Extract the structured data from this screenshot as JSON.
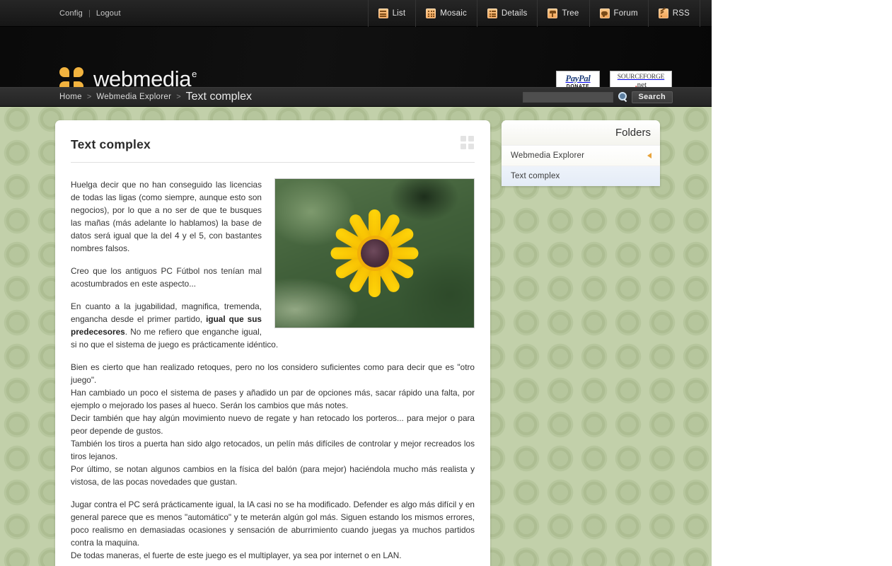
{
  "topbar": {
    "config_label": "Config",
    "separator": "|",
    "logout_label": "Logout",
    "nav": [
      {
        "label": "List",
        "icon": "list-icon"
      },
      {
        "label": "Mosaic",
        "icon": "mosaic-icon"
      },
      {
        "label": "Details",
        "icon": "details-icon"
      },
      {
        "label": "Tree",
        "icon": "tree-icon"
      },
      {
        "label": "Forum",
        "icon": "forum-icon"
      },
      {
        "label": "RSS",
        "icon": "rss-icon"
      }
    ]
  },
  "masthead": {
    "logo_text": "webmedia",
    "logo_superscript": "e",
    "logo_mark": "four-petal-flower-icon",
    "badges": {
      "paypal_line1": "PayPal",
      "paypal_line2": "DONATE",
      "sourceforge_line1": "SOURCEFORGE",
      "sourceforge_line2_dot": ".",
      "sourceforge_line2_net": "net"
    }
  },
  "breadcrumb": {
    "items": [
      "Home",
      "Webmedia Explorer",
      "Text complex"
    ],
    "separator": ">"
  },
  "search": {
    "value": "",
    "placeholder": "",
    "button_label": "Search",
    "icon": "search-icon"
  },
  "article": {
    "title": "Text complex",
    "grid_toggle_icon": "grid-view-icon",
    "image": {
      "alt": "yellow flower",
      "petal_count": 12
    },
    "paragraphs": [
      {
        "id": "p1",
        "text": "Huelga decir que no han conseguido las licencias de todas las ligas (como siempre, aunque esto son negocios), por lo que a no ser de que te busques las mañas (más adelante lo hablamos) la base de datos será igual que la del 4 y el 5, con bastantes nombres falsos."
      },
      {
        "id": "p2",
        "text": "Creo que los antiguos PC Fútbol nos tenían mal acostumbrados en este aspecto..."
      },
      {
        "id": "p3a",
        "text": "En cuanto a la jugabilidad, magnifica, tremenda, engancha desde el primer partido, "
      },
      {
        "id": "p3bold",
        "text": "igual que sus predecesores"
      },
      {
        "id": "p3b",
        "text": ". No me refiero que enganche igual, si no que el sistema de juego es prácticamente idéntico."
      },
      {
        "id": "p4",
        "text": "Bien es cierto que han realizado retoques, pero no los considero suficientes como para decir que es \"otro juego\"."
      },
      {
        "id": "p5",
        "text": "Han cambiado un poco el sistema de pases y añadido un par de opciones más, sacar rápido una falta, por ejemplo o mejorado los pases al hueco. Serán los cambios que más notes."
      },
      {
        "id": "p6",
        "text": "Decir también que hay algún movimiento nuevo de regate y han retocado los porteros... para mejor o para peor depende de gustos."
      },
      {
        "id": "p7",
        "text": "También los tiros a puerta han sido algo retocados, un pelín más difíciles de controlar y mejor recreados los tiros lejanos."
      },
      {
        "id": "p8",
        "text": "Por último, se notan algunos cambios en la física del balón (para mejor) haciéndola mucho más realista y vistosa, de las pocas novedades que gustan."
      },
      {
        "id": "p9",
        "text": "Jugar contra el PC será prácticamente igual, la IA casi no se ha modificado. Defender es algo más difícil y en general parece que es menos \"automático\" y te meterán algún gol más. Siguen estando los mismos errores, poco realismo en demasiadas ocasiones y sensación de aburrimiento cuando juegas ya muchos partidos contra la maquina."
      },
      {
        "id": "p10",
        "text": "De todas maneras, el fuerte de este juego es el multiplayer, ya sea por internet o en LAN."
      }
    ]
  },
  "folders": {
    "title": "Folders",
    "items": [
      {
        "label": "Webmedia Explorer",
        "active": false,
        "has_arrow": true
      },
      {
        "label": "Text complex",
        "active": true,
        "has_arrow": false
      }
    ]
  },
  "colors": {
    "accent_orange": "#f2b33f",
    "page_background": "#c2d0aa",
    "header_black": "#080808",
    "active_row_blue": "#e4ecf7"
  }
}
